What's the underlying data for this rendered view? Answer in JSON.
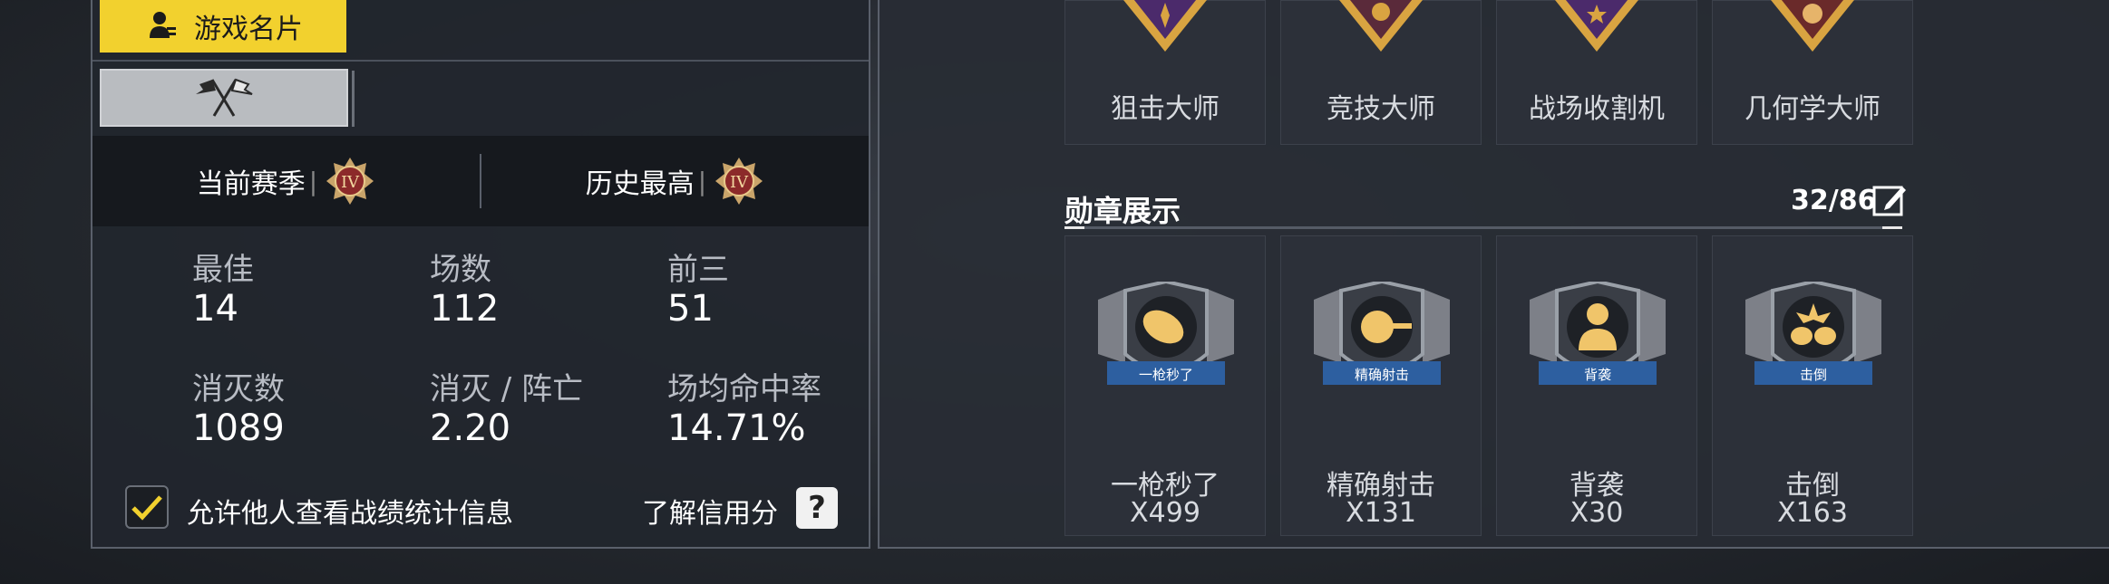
{
  "left": {
    "card_button_label": "游戏名片",
    "current_season_label": "当前赛季",
    "history_best_label": "历史最高",
    "current_season_rank": "IV",
    "history_best_rank": "IV",
    "stats": [
      {
        "label": "最佳",
        "value": "14"
      },
      {
        "label": "场数",
        "value": "112"
      },
      {
        "label": "前三",
        "value": "51"
      },
      {
        "label": "消灭数",
        "value": "1089"
      },
      {
        "label": "消灭 / 阵亡",
        "value": "2.20"
      },
      {
        "label": "场均命中率",
        "value": "14.71%"
      }
    ],
    "allow_stats_label": "允许他人查看战绩统计信息",
    "allow_stats_checked": true,
    "credit_label": "了解信用分",
    "help_icon_text": "?"
  },
  "right": {
    "top_titles": [
      "狙击大师",
      "竞技大师",
      "战场收割机",
      "几何学大师"
    ],
    "medal_section_title": "勋章展示",
    "medal_progress": "32/86",
    "medals": [
      {
        "ribbon": "一枪秒了",
        "name": "一枪秒了",
        "count": "X499"
      },
      {
        "ribbon": "精确射击",
        "name": "精确射击",
        "count": "X131"
      },
      {
        "ribbon": "背袭",
        "name": "背袭",
        "count": "X30"
      },
      {
        "ribbon": "击倒",
        "name": "击倒",
        "count": "X163"
      }
    ]
  },
  "colors": {
    "accent_yellow": "#f2d12e",
    "medal_gold": "#d9a441",
    "medal_purple": "#4b2a6b",
    "ribbon_blue": "#2d5fa0"
  }
}
